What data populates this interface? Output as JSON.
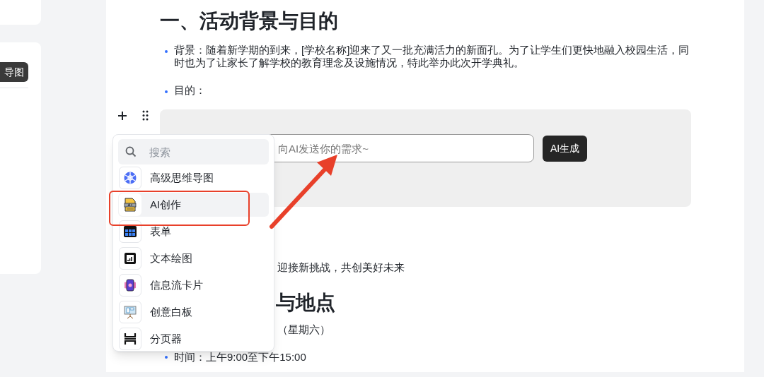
{
  "sidebar": {
    "chip": "导图"
  },
  "document": {
    "heading": "一、活动背景与目的",
    "bullets": [
      {
        "text": "背景：随着新学期的到来，[学校名称]迎来了又一批充满活力的新面孔。为了让学生们更快地融入校园生活，同时也为了让家长了解学校的教育理念及设施情况，特此举办此次开学典礼。"
      },
      {
        "text": "目的："
      }
    ]
  },
  "ai_block": {
    "placeholder": "向AI发送你的需求~",
    "button": "AI生成"
  },
  "insert_menu": {
    "search_placeholder": "搜索",
    "items": [
      {
        "kind": "mindmap",
        "label": "高级思维导图",
        "selected": false
      },
      {
        "kind": "ai",
        "label": "AI创作",
        "selected": true
      },
      {
        "kind": "form",
        "label": "表单",
        "selected": false
      },
      {
        "kind": "chart",
        "label": "文本绘图",
        "selected": false
      },
      {
        "kind": "card",
        "label": "信息流卡片",
        "selected": false
      },
      {
        "kind": "whiteboard",
        "label": "创意白板",
        "selected": false
      },
      {
        "kind": "pager",
        "label": "分页器",
        "selected": false
      }
    ]
  },
  "hidden_content": [
    {
      "kind": "paragraph",
      "text": "迎接新挑战，共创美好未来"
    },
    {
      "kind": "heading",
      "text": "与地点"
    },
    {
      "kind": "paragraph",
      "text": "（星期六）"
    },
    {
      "kind": "bullet",
      "text": "时间：上午9:00至下午15:00"
    }
  ]
}
